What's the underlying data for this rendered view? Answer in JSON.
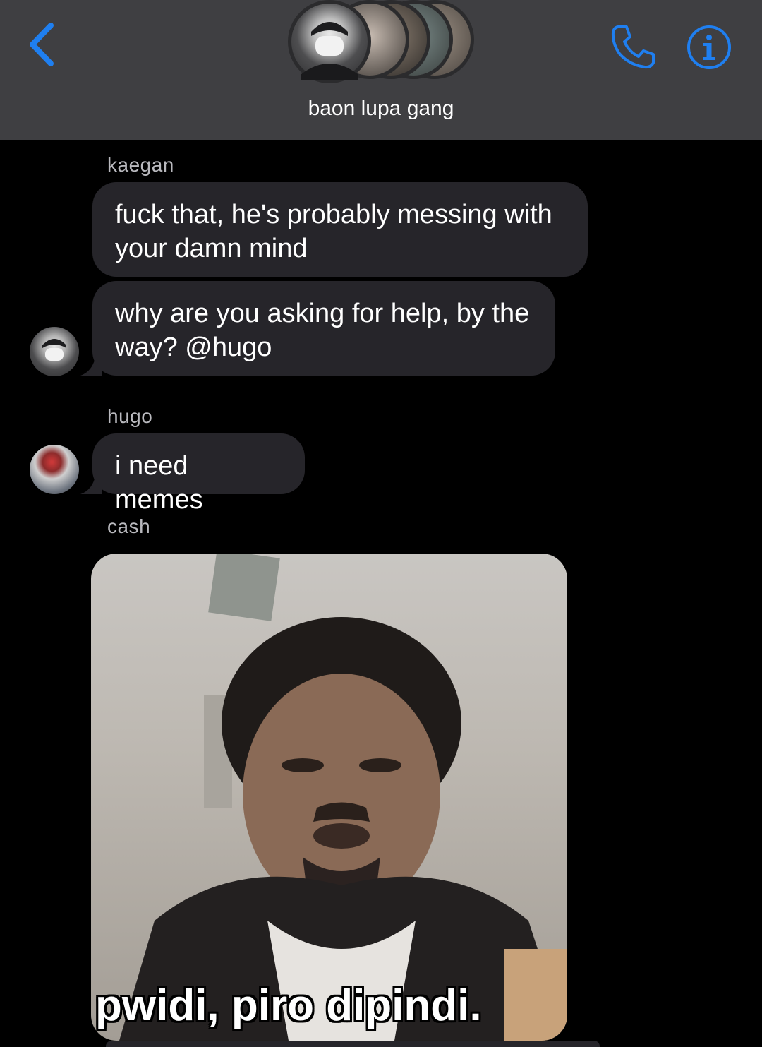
{
  "header": {
    "title": "baon lupa gang",
    "accent_color": "#1f7ff0"
  },
  "messages": [
    {
      "sender": "kaegan",
      "texts": [
        "fuck that, he's probably messing with your damn mind",
        "why are you asking for help, by the way? @hugo"
      ]
    },
    {
      "sender": "hugo",
      "texts": [
        "i need memes"
      ]
    },
    {
      "sender": "cash",
      "image_caption": "pwidi, piro dipindi."
    }
  ],
  "icons": {
    "back": "chevron-left-icon",
    "call": "phone-icon",
    "info": "info-icon"
  },
  "colors": {
    "header_bg": "#3f3f42",
    "bubble_bg": "#26252a",
    "background": "#000000"
  }
}
